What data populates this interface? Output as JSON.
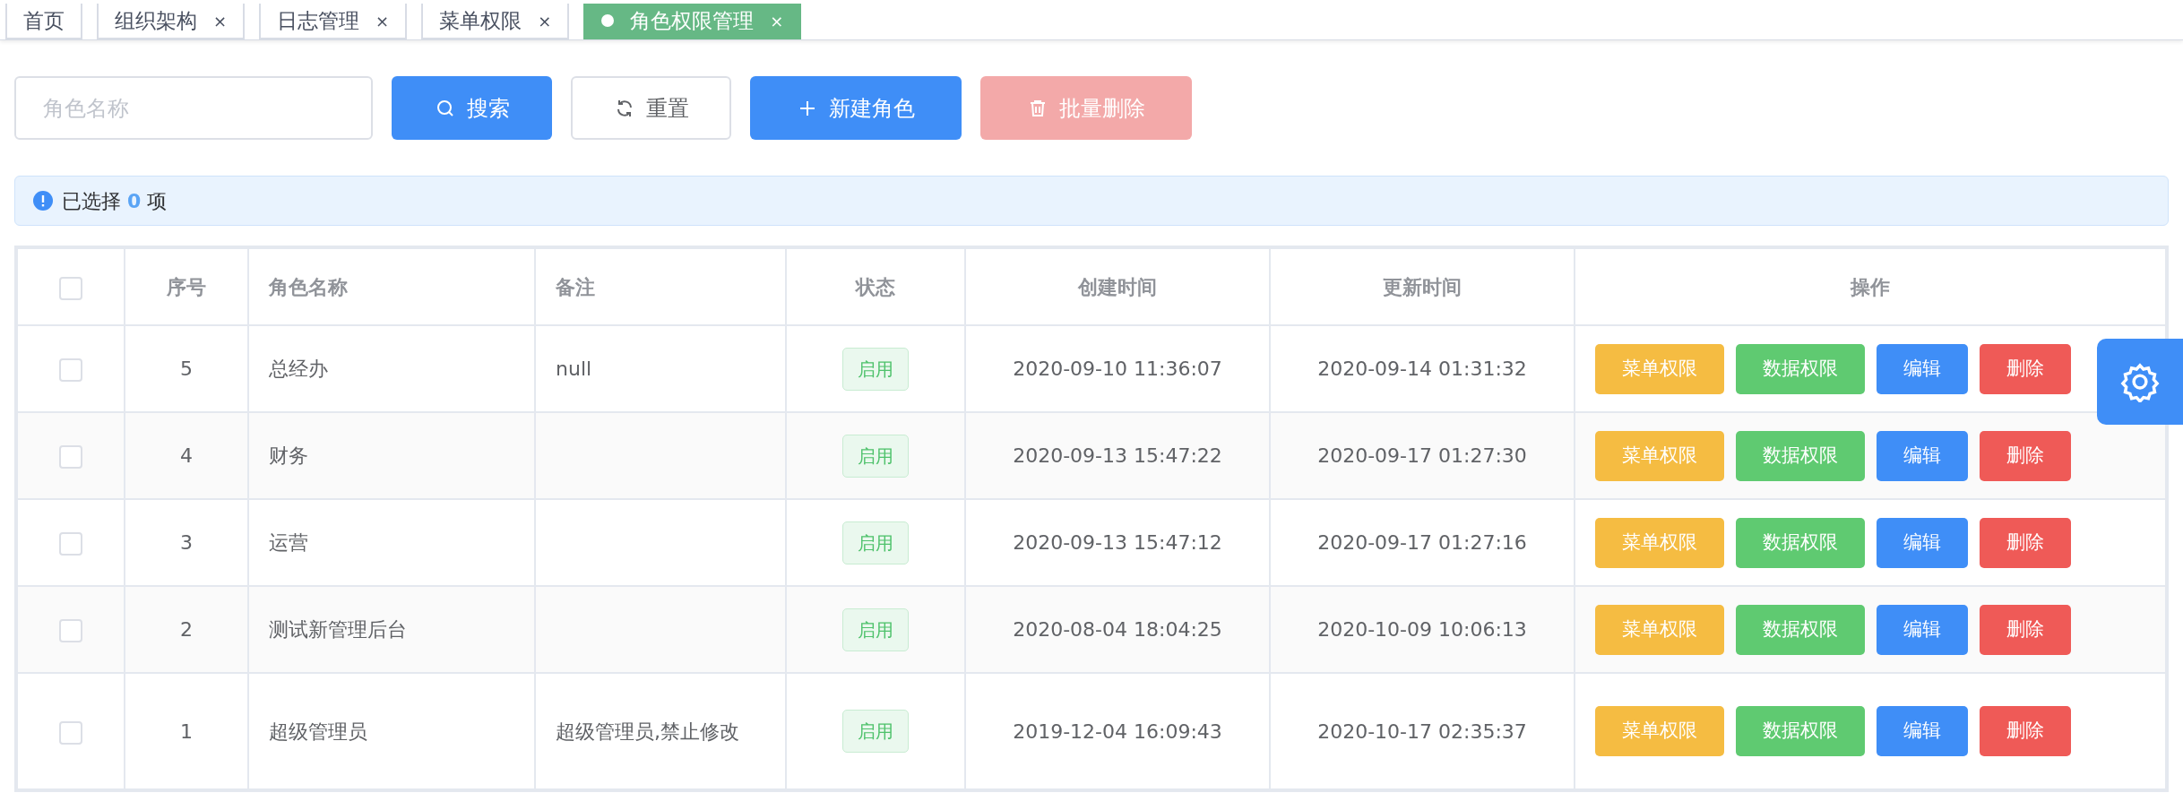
{
  "tabs": [
    {
      "label": "首页",
      "selected": false
    },
    {
      "label": "组织架构",
      "close": "×",
      "selected": false
    },
    {
      "label": "日志管理",
      "close": "×",
      "selected": false
    },
    {
      "label": "菜单权限",
      "close": "×",
      "selected": false
    },
    {
      "label": "角色权限管理",
      "close": "×",
      "selected": true
    }
  ],
  "search": {
    "placeholder": "角色名称"
  },
  "buttons": [
    {
      "label": "搜索",
      "kind": "search",
      "disabled": false
    },
    {
      "label": "重置",
      "kind": "reset",
      "disabled": false
    },
    {
      "label": "新建角色",
      "kind": "create",
      "disabled": false
    },
    {
      "label": "批量删除",
      "kind": "delete",
      "disabled": true
    }
  ],
  "alert": {
    "prefix": "已选择",
    "count": "0",
    "suffix": "项"
  },
  "table": {
    "header_checked": false,
    "columns": [
      "序号",
      "角色名称",
      "备注",
      "状态",
      "创建时间",
      "更新时间",
      "操作"
    ],
    "rows": [
      {
        "checked": false,
        "index": "5",
        "name": "总经办",
        "remark": "null",
        "status": "启用",
        "created": "2020-09-10 11:36:07",
        "updated": "2020-09-14 01:31:32",
        "actions": [
          {
            "label": "菜单权限",
            "kind": "menu"
          },
          {
            "label": "数据权限",
            "kind": "data"
          },
          {
            "label": "编辑",
            "kind": "edit"
          },
          {
            "label": "删除",
            "kind": "delete"
          }
        ]
      },
      {
        "checked": false,
        "index": "4",
        "name": "财务",
        "remark": "",
        "status": "启用",
        "created": "2020-09-13 15:47:22",
        "updated": "2020-09-17 01:27:30",
        "actions": [
          {
            "label": "菜单权限",
            "kind": "menu"
          },
          {
            "label": "数据权限",
            "kind": "data"
          },
          {
            "label": "编辑",
            "kind": "edit"
          },
          {
            "label": "删除",
            "kind": "delete"
          }
        ]
      },
      {
        "checked": false,
        "index": "3",
        "name": "运营",
        "remark": "",
        "status": "启用",
        "created": "2020-09-13 15:47:12",
        "updated": "2020-09-17 01:27:16",
        "actions": [
          {
            "label": "菜单权限",
            "kind": "menu"
          },
          {
            "label": "数据权限",
            "kind": "data"
          },
          {
            "label": "编辑",
            "kind": "edit"
          },
          {
            "label": "删除",
            "kind": "delete"
          }
        ]
      },
      {
        "checked": false,
        "index": "2",
        "name": "测试新管理后台",
        "remark": "",
        "status": "启用",
        "created": "2020-08-04 18:04:25",
        "updated": "2020-10-09 10:06:13",
        "actions": [
          {
            "label": "菜单权限",
            "kind": "menu"
          },
          {
            "label": "数据权限",
            "kind": "data"
          },
          {
            "label": "编辑",
            "kind": "edit"
          },
          {
            "label": "删除",
            "kind": "delete"
          }
        ]
      },
      {
        "checked": false,
        "index": "1",
        "name": "超级管理员",
        "remark": "超级管理员,禁止修改",
        "status": "启用",
        "created": "2019-12-04 16:09:43",
        "updated": "2020-10-17 02:35:37",
        "actions": [
          {
            "label": "菜单权限",
            "kind": "menu"
          },
          {
            "label": "数据权限",
            "kind": "data"
          },
          {
            "label": "编辑",
            "kind": "edit"
          },
          {
            "label": "删除",
            "kind": "delete"
          }
        ]
      }
    ]
  }
}
